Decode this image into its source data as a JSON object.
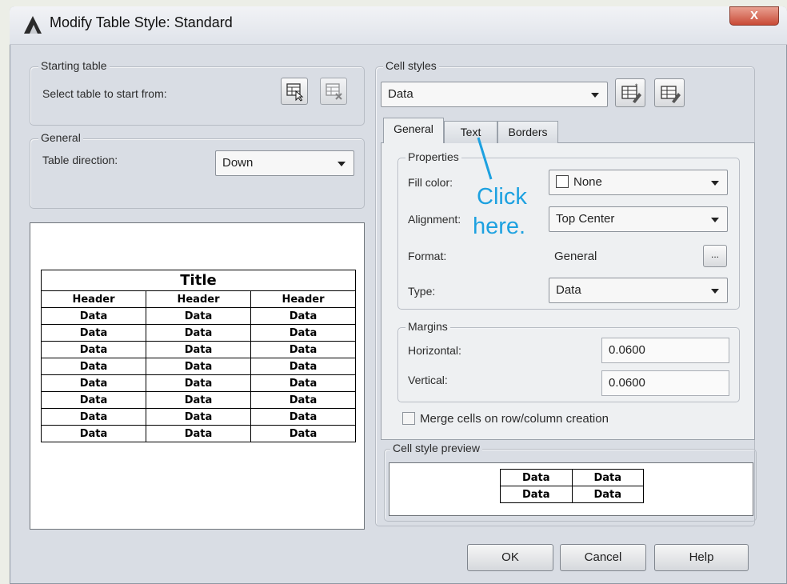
{
  "window": {
    "title": "Modify Table Style: Standard",
    "close_label": "X"
  },
  "starting_table": {
    "legend": "Starting table",
    "select_label": "Select table to start from:"
  },
  "general": {
    "legend": "General",
    "direction_label": "Table direction:",
    "direction_value": "Down"
  },
  "preview": {
    "title": "Title",
    "headers": [
      "Header",
      "Header",
      "Header"
    ],
    "rows": [
      [
        "Data",
        "Data",
        "Data"
      ],
      [
        "Data",
        "Data",
        "Data"
      ],
      [
        "Data",
        "Data",
        "Data"
      ],
      [
        "Data",
        "Data",
        "Data"
      ],
      [
        "Data",
        "Data",
        "Data"
      ],
      [
        "Data",
        "Data",
        "Data"
      ],
      [
        "Data",
        "Data",
        "Data"
      ],
      [
        "Data",
        "Data",
        "Data"
      ]
    ]
  },
  "cell_styles": {
    "legend": "Cell styles",
    "selected": "Data"
  },
  "tabs": [
    {
      "label": "General",
      "active": true
    },
    {
      "label": "Text",
      "active": false
    },
    {
      "label": "Borders",
      "active": false
    }
  ],
  "properties": {
    "legend": "Properties",
    "fill_color_label": "Fill color:",
    "fill_color_value": "None",
    "alignment_label": "Alignment:",
    "alignment_value": "Top Center",
    "format_label": "Format:",
    "format_value": "General",
    "format_button": "...",
    "type_label": "Type:",
    "type_value": "Data"
  },
  "margins": {
    "legend": "Margins",
    "horizontal_label": "Horizontal:",
    "horizontal_value": "0.0600",
    "vertical_label": "Vertical:",
    "vertical_value": "0.0600"
  },
  "merge_label": "Merge cells on row/column creation",
  "cell_style_preview": {
    "legend": "Cell style preview",
    "cells": [
      [
        "Data",
        "Data"
      ],
      [
        "Data",
        "Data"
      ]
    ]
  },
  "annotation": {
    "line1": "Click",
    "line2": "here."
  },
  "buttons": {
    "ok": "OK",
    "cancel": "Cancel",
    "help": "Help"
  },
  "colors": {
    "annotation": "#1da1e0",
    "close_button": "#c94a36",
    "dialog_bg": "#d9dde4"
  }
}
